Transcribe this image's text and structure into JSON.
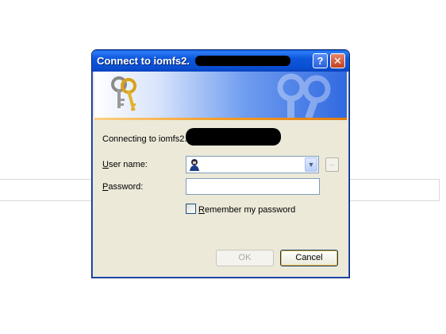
{
  "window": {
    "title": "Connect to iomfs2.",
    "help_label": "?",
    "close_label": "✕"
  },
  "banner": {
    "icon": "keys-icon",
    "watermark": "keys-watermark-icon"
  },
  "dialog": {
    "connecting_text": "Connecting to iomfs2.",
    "user_label_first": "U",
    "user_label_rest": "ser name:",
    "user_value": "",
    "password_label_first": "P",
    "password_label_rest": "assword:",
    "password_value": "",
    "browse_label": "...",
    "remember_first": "R",
    "remember_rest": "emember my password",
    "remember_checked": false,
    "ok_label": "OK",
    "cancel_label": "Cancel"
  },
  "colors": {
    "titlebar": "#0a4fd2",
    "dialog_bg": "#ece9d8",
    "accent_line": "#f39c28"
  }
}
